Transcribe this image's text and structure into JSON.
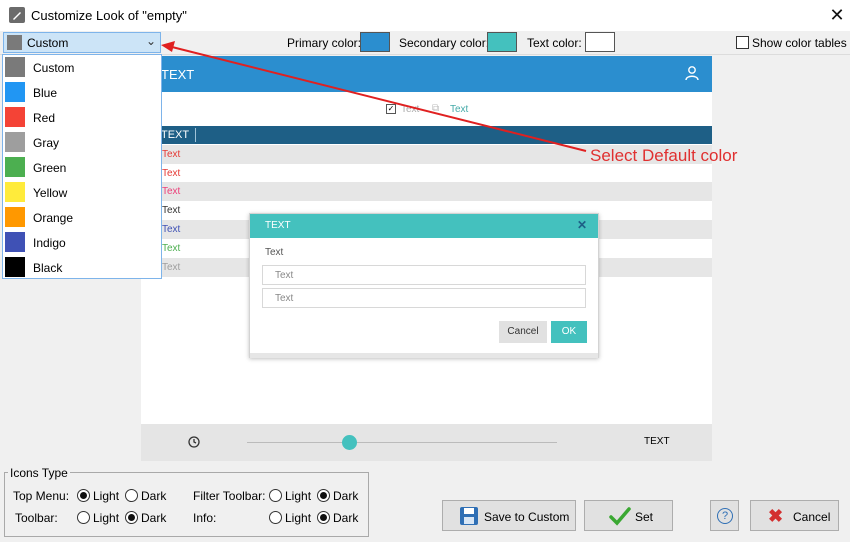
{
  "window": {
    "title": "Customize Look of \"empty\"",
    "close_glyph": "✕"
  },
  "toolbar": {
    "preset_value": "Custom",
    "primary_label": "Primary color:",
    "primary_color": "#2b8ecf",
    "secondary_label": "Secondary color:",
    "secondary_color": "#44c1be",
    "text_label": "Text color:",
    "text_color": "#ffffff",
    "show_tables_label": "Show color tables"
  },
  "dropdown": {
    "items": [
      {
        "label": "Custom",
        "color": "#7a7a7a"
      },
      {
        "label": "Blue",
        "color": "#2196f3"
      },
      {
        "label": "Red",
        "color": "#f44336"
      },
      {
        "label": "Gray",
        "color": "#9e9e9e"
      },
      {
        "label": "Green",
        "color": "#4caf50"
      },
      {
        "label": "Yellow",
        "color": "#ffeb3b"
      },
      {
        "label": "Orange",
        "color": "#ff9800"
      },
      {
        "label": "Indigo",
        "color": "#3f51b5"
      },
      {
        "label": "Black",
        "color": "#000000"
      }
    ]
  },
  "preview": {
    "header_text": "TEXT",
    "check_text": "Text",
    "link_text": "Text",
    "table_head": "TEXT",
    "rows": [
      {
        "text": "Text",
        "color": "#e53935"
      },
      {
        "text": "Text",
        "color": "#e53935"
      },
      {
        "text": "Text",
        "color": "#ec407a"
      },
      {
        "text": "Text",
        "color": "#333333"
      },
      {
        "text": "Text",
        "color": "#3f51b5"
      },
      {
        "text": "Text",
        "color": "#4caf50"
      },
      {
        "text": "Text",
        "color": "#9e9e9e"
      }
    ],
    "modal": {
      "title": "TEXT",
      "label": "Text",
      "field1_placeholder": "Text",
      "field2_placeholder": "Text",
      "cancel": "Cancel",
      "ok": "OK"
    },
    "footer_text": "TEXT",
    "slider_fraction": 0.33
  },
  "annotation": "Select Default color",
  "icons_type": {
    "title": "Icons Type",
    "top_menu_label": "Top Menu:",
    "toolbar_label": "Toolbar:",
    "filter_toolbar_label": "Filter Toolbar:",
    "info_label": "Info:",
    "light": "Light",
    "dark": "Dark"
  },
  "buttons": {
    "save_custom": "Save to Custom",
    "set": "Set",
    "help": "?",
    "cancel": "Cancel"
  }
}
